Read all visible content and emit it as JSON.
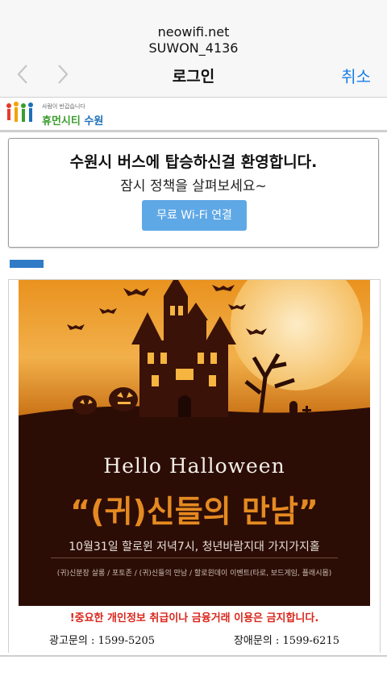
{
  "header": {
    "network": "neowifi.net",
    "ssid": "SUWON_4136",
    "title": "로그인",
    "cancel_label": "취소",
    "back_icon": "chevron-left-icon",
    "forward_icon": "chevron-right-icon"
  },
  "logo": {
    "tagline": "사람이 반갑습니다",
    "name_part1": "휴먼시티",
    "name_part2": " 수원"
  },
  "welcome": {
    "title": "수원시 버스에 탑승하신걸 환영합니다.",
    "subtitle": "잠시 정책을 살펴보세요~",
    "button_label": "무료 Wi-Fi 연결"
  },
  "ad": {
    "hello": "Hello Halloween",
    "headline": "“(귀)신들의 만남”",
    "date_line": "10월31일 할로윈 저녁7시, 청년바람지대 가지가지홀",
    "events": "(귀)신분장 살롱 / 포토존 / (귀)신들의 만남 / 할로윈데이 이벤트(타로, 보드게임, 플래시몹)",
    "warning": "!중요한 개인정보 취급이나 금융거래 이용은 금지합니다.",
    "ad_contact": "광고문의 : 1599-5205",
    "help_contact": "장애문의 : 1599-6215"
  },
  "colors": {
    "accent": "#1a7fe8",
    "button": "#5fa8e6",
    "warning": "#d9261c",
    "poster_orange": "#e58a21"
  }
}
